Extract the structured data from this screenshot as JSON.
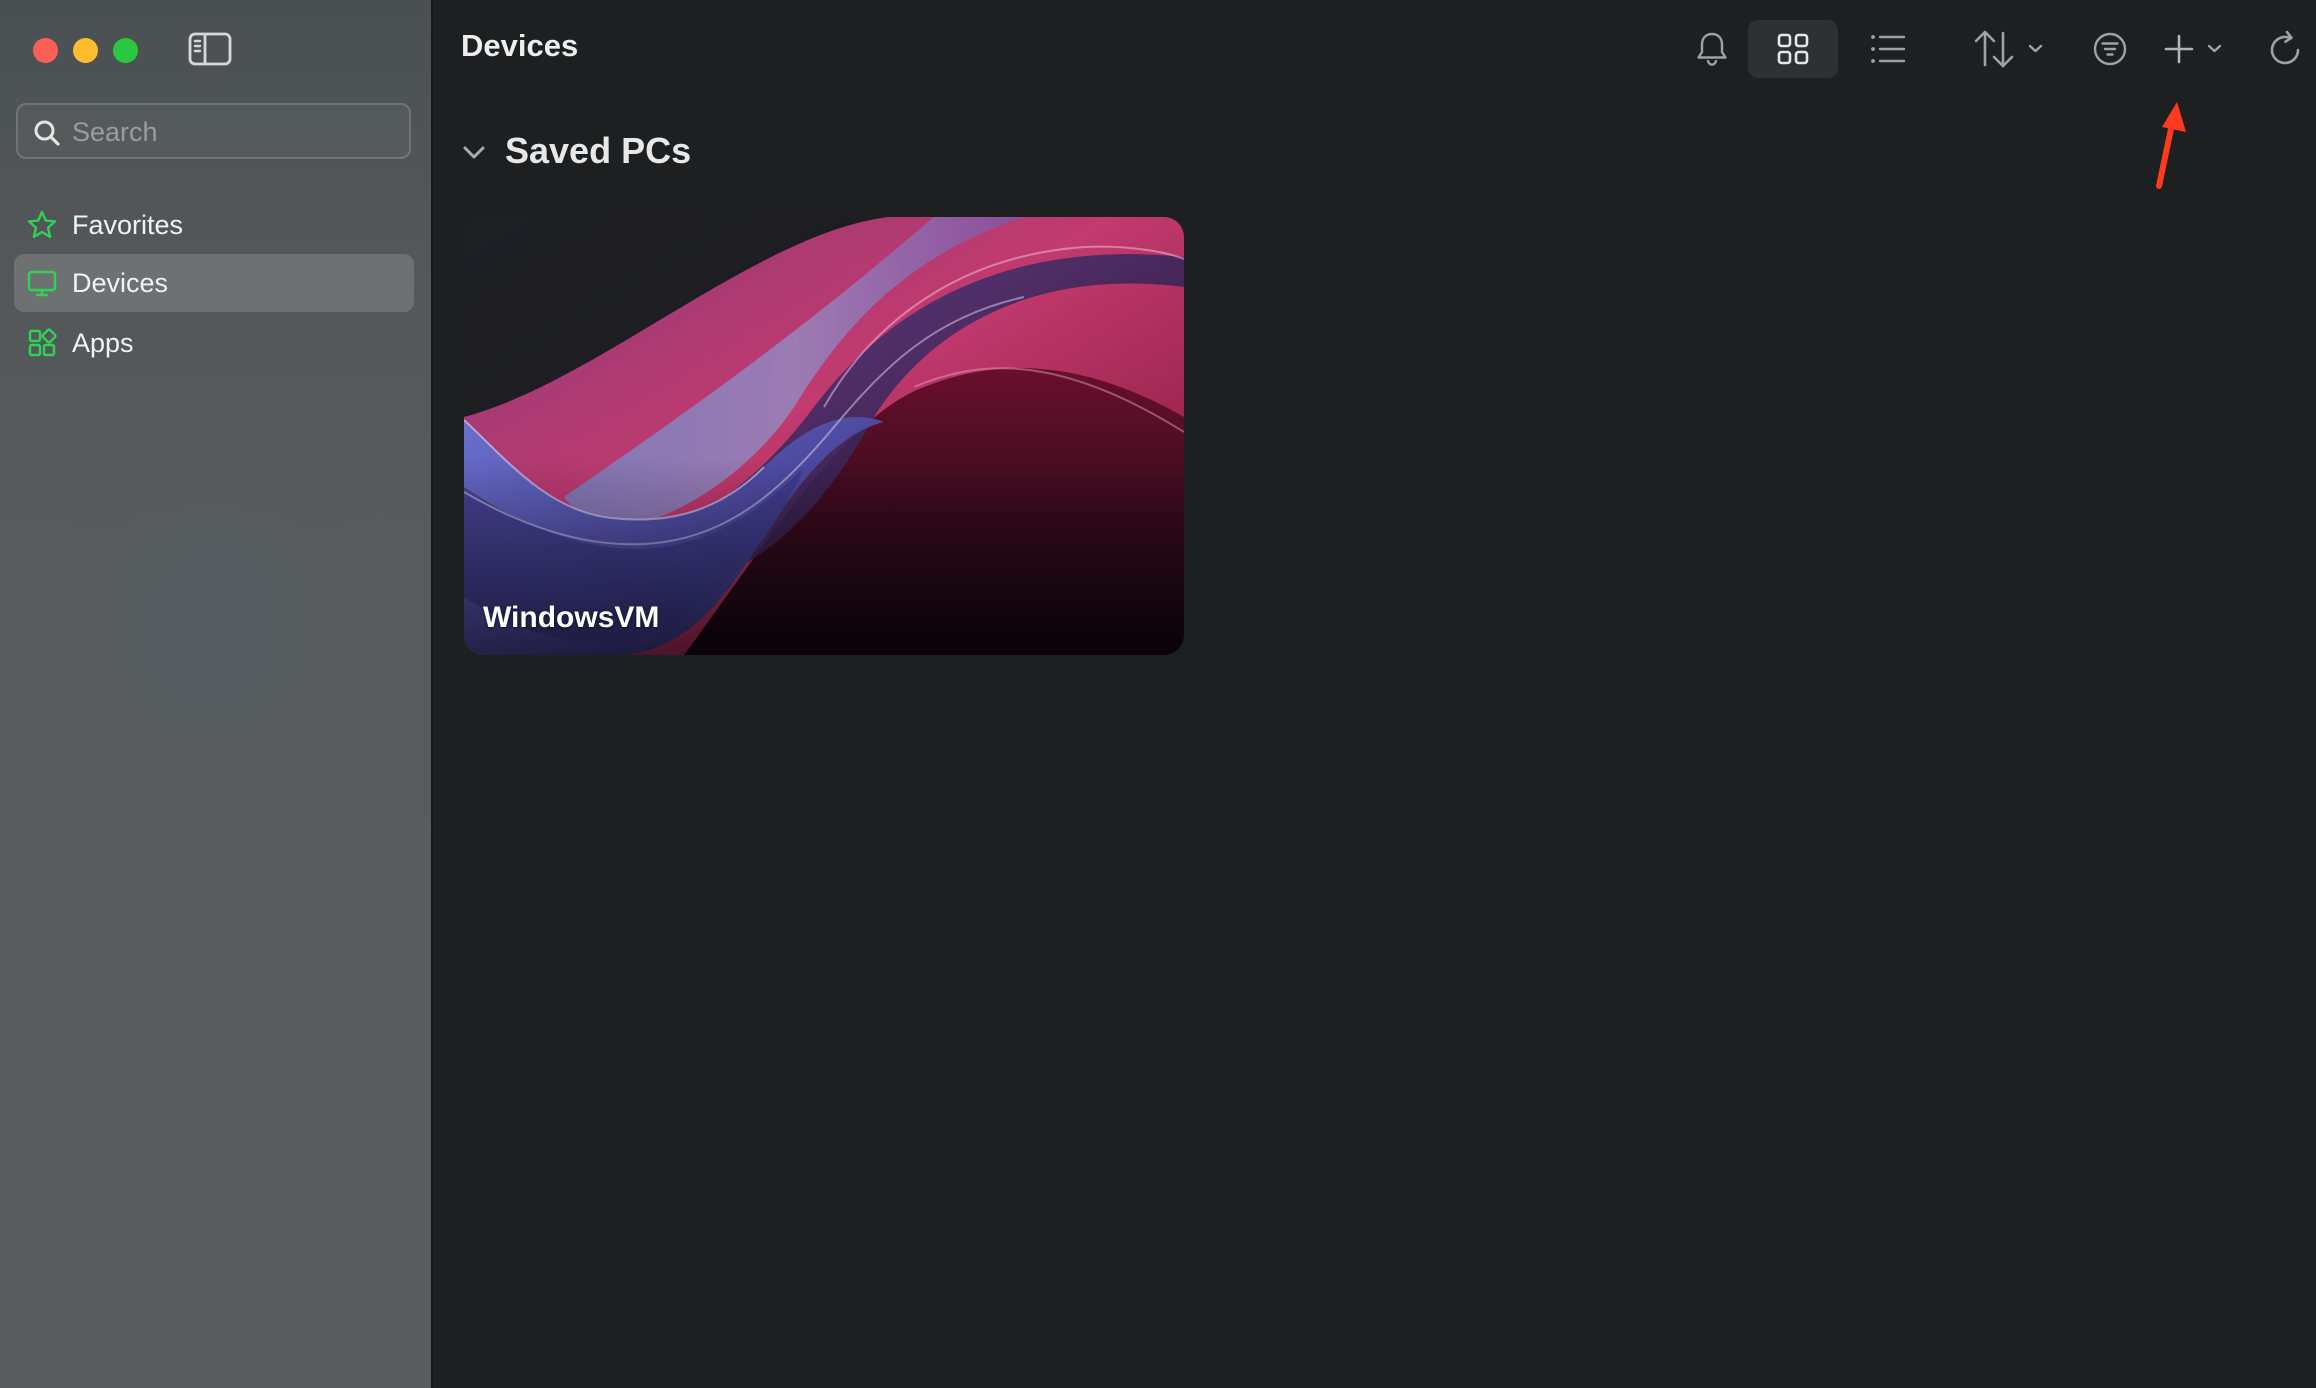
{
  "window": {
    "traffic_lights": [
      "close",
      "minimize",
      "zoom"
    ]
  },
  "sidebar": {
    "toggle_icon": "sidebar-toggle-icon",
    "search": {
      "placeholder": "Search",
      "value": ""
    },
    "items": [
      {
        "label": "Favorites",
        "icon": "star-icon",
        "selected": false
      },
      {
        "label": "Devices",
        "icon": "monitor-icon",
        "selected": true
      },
      {
        "label": "Apps",
        "icon": "apps-grid-icon",
        "selected": false
      }
    ],
    "accent_color": "#30d158"
  },
  "header": {
    "title": "Devices",
    "toolbar": [
      "bell-icon",
      "grid-view-icon",
      "list-view-icon",
      "sort-icon",
      "filter-icon",
      "add-icon",
      "refresh-icon"
    ],
    "active_view": "grid"
  },
  "main": {
    "section": {
      "title": "Saved PCs",
      "expanded": true
    },
    "devices": [
      {
        "name": "WindowsVM"
      }
    ]
  },
  "annotation": {
    "arrow_color": "#ff3b1f",
    "points_to": "add-icon"
  }
}
